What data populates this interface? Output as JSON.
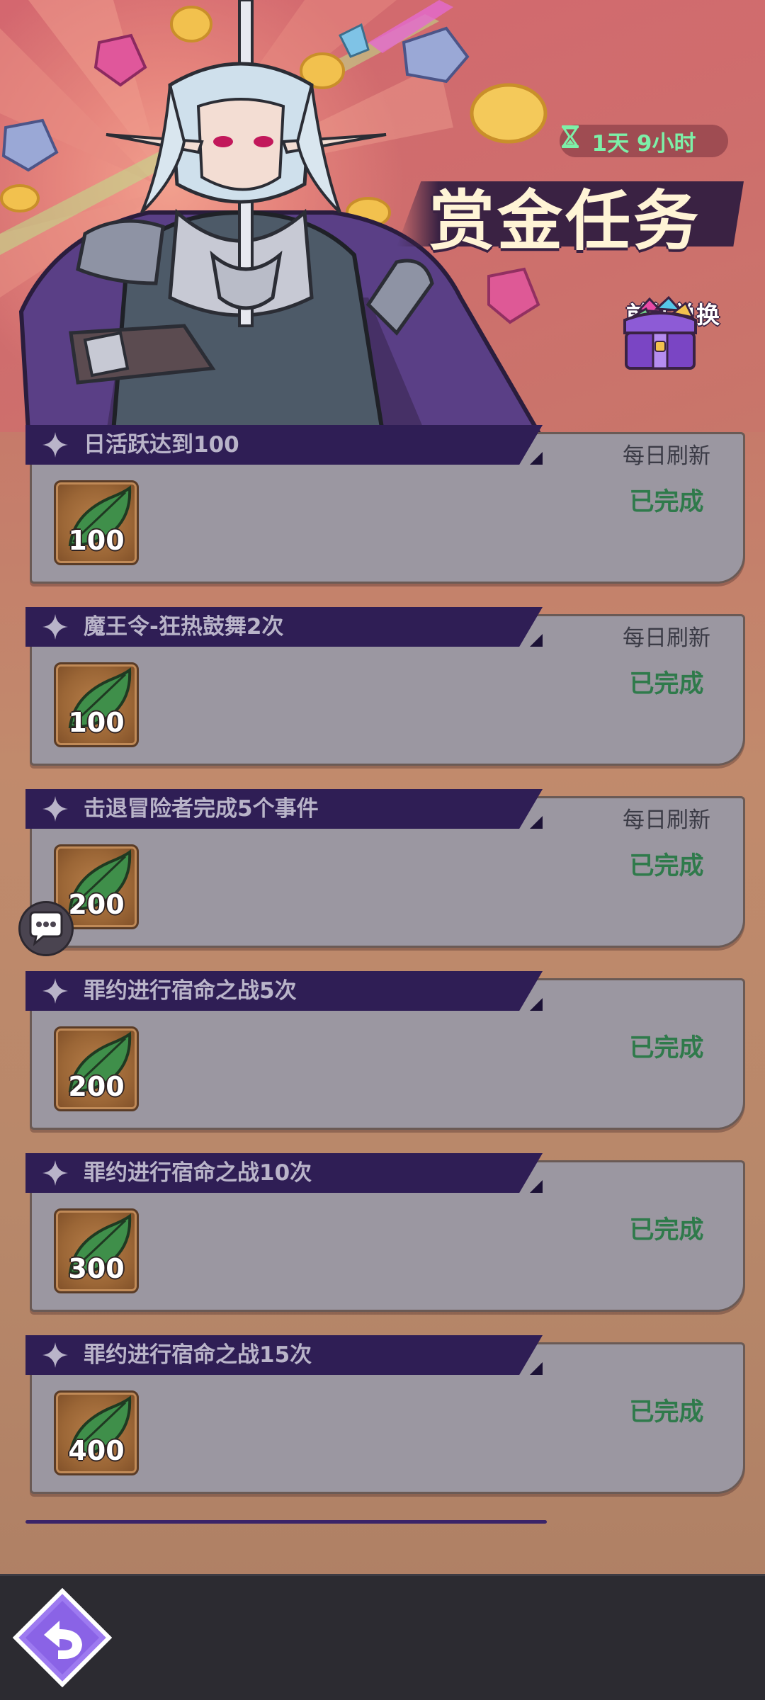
{
  "header": {
    "title": "赏金任务",
    "timer": "1天 9小时",
    "exchange_label": "前往兑换"
  },
  "tasks": [
    {
      "title": "日活跃达到100",
      "refresh": "每日刷新",
      "status": "已完成",
      "reward": "100"
    },
    {
      "title": "魔王令-狂热鼓舞2次",
      "refresh": "每日刷新",
      "status": "已完成",
      "reward": "100"
    },
    {
      "title": "击退冒险者完成5个事件",
      "refresh": "每日刷新",
      "status": "已完成",
      "reward": "200"
    },
    {
      "title": "罪约进行宿命之战5次",
      "refresh": "",
      "status": "已完成",
      "reward": "200"
    },
    {
      "title": "罪约进行宿命之战10次",
      "refresh": "",
      "status": "已完成",
      "reward": "300"
    },
    {
      "title": "罪约进行宿命之战15次",
      "refresh": "",
      "status": "已完成",
      "reward": "400"
    }
  ],
  "icons": {
    "timer": "hourglass-icon",
    "exchange": "treasure-chest-icon",
    "task_marker": "sparkle-star-icon",
    "reward": "green-leaf-icon",
    "chat": "chat-bubble-icon",
    "back": "back-arrow-icon"
  },
  "colors": {
    "ribbon": "#2f1e55",
    "card": "#9b97a1",
    "status_done": "#2f7a4b",
    "timer_text": "#7df0a8",
    "back_button": "#9d7af0"
  }
}
